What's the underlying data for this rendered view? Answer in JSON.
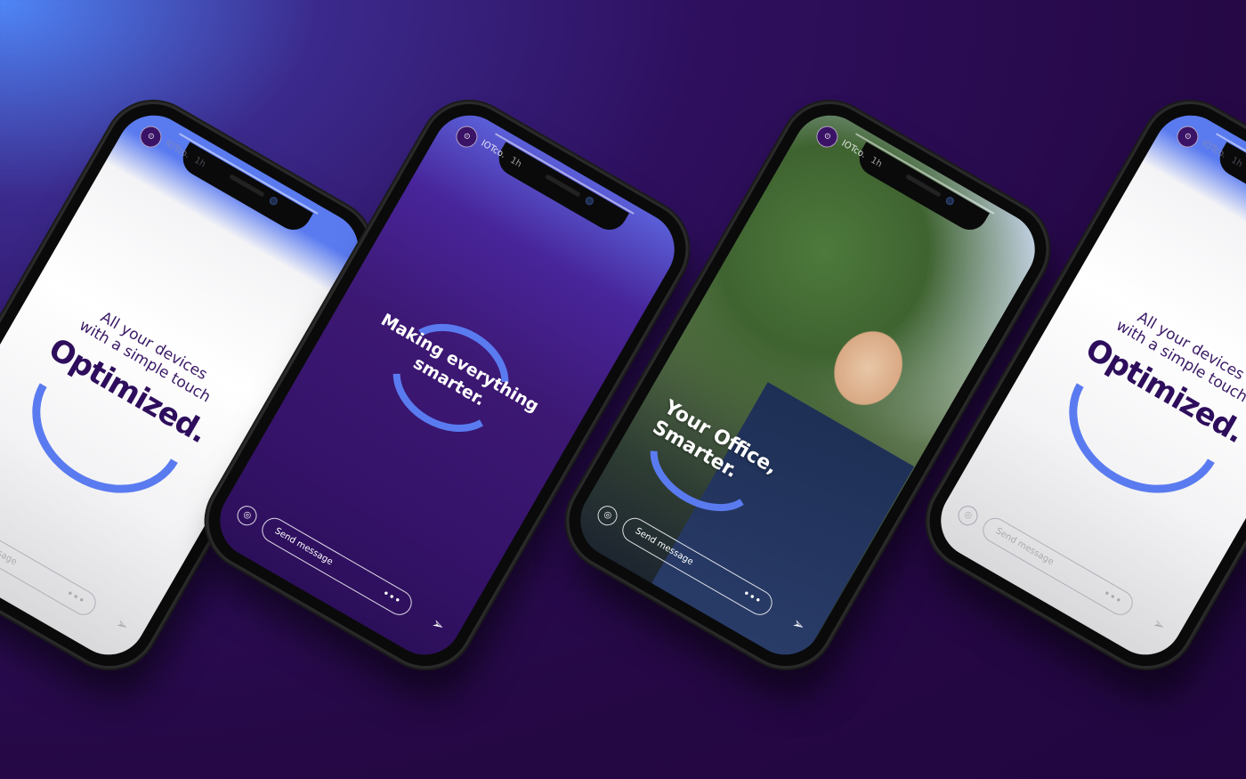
{
  "story": {
    "account_name": "IOTco.",
    "time_ago": "1h",
    "avatar_glyph": "⊙",
    "send_placeholder": "Send message",
    "more_glyph": "•••",
    "send_glyph": "➢",
    "camera_glyph": "◎"
  },
  "screens": {
    "optimized": {
      "subtitle_line1": "All your devices",
      "subtitle_line2": "with a simple touch",
      "headline": "Optimized."
    },
    "smarter": {
      "headline_line1": "Making everything",
      "headline_line2": "smarter."
    },
    "office": {
      "headline_line1": "Your Office,",
      "headline_line2": "Smarter."
    }
  },
  "colors": {
    "accent_blue": "#5a7bf0",
    "brand_purple": "#2e0e5c",
    "background_purple": "#250845"
  }
}
